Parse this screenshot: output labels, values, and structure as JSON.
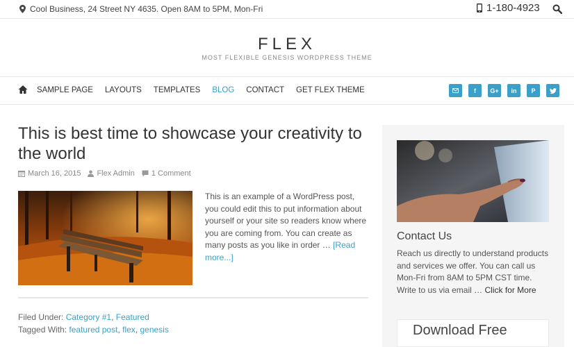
{
  "topbar": {
    "address": "Cool Business, 24 Street NY 4635. Open 8AM to 5PM, Mon-Fri",
    "phone": "1-180-4923"
  },
  "header": {
    "title": "FLEX",
    "description": "MOST FLEXIBLE GENESIS WORDPRESS THEME"
  },
  "nav": {
    "items": [
      {
        "label": "SAMPLE PAGE"
      },
      {
        "label": "LAYOUTS"
      },
      {
        "label": "TEMPLATES"
      },
      {
        "label": "BLOG"
      },
      {
        "label": "CONTACT"
      },
      {
        "label": "GET FLEX THEME"
      }
    ],
    "active": "BLOG",
    "social": [
      "email",
      "facebook",
      "google-plus",
      "linkedin",
      "pinterest",
      "twitter"
    ]
  },
  "post": {
    "title": "This is best time to showcase your creativity to the world",
    "date": "March 16, 2015",
    "author": "Flex Admin",
    "comments": "1 Comment",
    "excerpt": "This is an example of a WordPress post, you could edit this to put information about yourself or your site so readers know where you are coming from. You can create as many posts as you like in order …",
    "read_more": "[Read more...]",
    "filed_label": "Filed Under:",
    "categories": [
      "Category #1",
      "Featured"
    ],
    "tagged_label": "Tagged With:",
    "tags": [
      "featured post",
      "flex",
      "genesis"
    ]
  },
  "sidebar": {
    "contact_heading": "Contact Us",
    "contact_text": "Reach us directly to understand products and services we offer. You can call us Mon-Fri from 8AM to 5PM CST time. Write to us via email …",
    "contact_more": "Click for More",
    "download_heading": "Download Free"
  },
  "colors": {
    "accent": "#3b9fc8",
    "text": "#666666",
    "sidebar_bg": "#f5f5f5"
  }
}
